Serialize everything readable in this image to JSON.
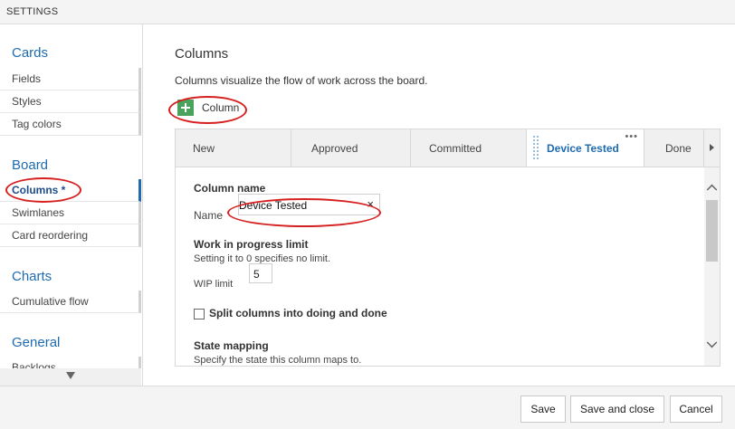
{
  "window": {
    "title": "SETTINGS"
  },
  "sidebar": {
    "sections": [
      {
        "title": "Cards",
        "items": [
          "Fields",
          "Styles",
          "Tag colors"
        ]
      },
      {
        "title": "Board",
        "items": [
          "Columns *",
          "Swimlanes",
          "Card reordering"
        ],
        "active": "Columns *"
      },
      {
        "title": "Charts",
        "items": [
          "Cumulative flow"
        ]
      },
      {
        "title": "General",
        "items": [
          "Backlogs"
        ]
      }
    ]
  },
  "main": {
    "title": "Columns",
    "description": "Columns visualize the flow of work across the board.",
    "add_column_label": "Column",
    "tabs": [
      {
        "label": "New"
      },
      {
        "label": "Approved"
      },
      {
        "label": "Committed"
      },
      {
        "label": "Device Tested",
        "active": true
      },
      {
        "label": "Done"
      }
    ],
    "form": {
      "column_name_heading": "Column name",
      "name_label": "Name",
      "name_value": "Device Tested",
      "clear_symbol": "×",
      "wip_heading": "Work in progress limit",
      "wip_hint": "Setting it to 0 specifies no limit.",
      "wip_label": "WIP limit",
      "wip_value": "5",
      "split_label": "Split columns into doing and done",
      "split_checked": false,
      "state_heading": "State mapping",
      "state_hint": "Specify the state this column maps to."
    }
  },
  "footer": {
    "save_label": "Save",
    "save_close_label": "Save and close",
    "cancel_label": "Cancel"
  },
  "colors": {
    "accent": "#1e6bb0",
    "add_button": "#4aa35c",
    "annotation": "#d62020"
  },
  "icons": {
    "add": "plus-icon",
    "clear": "close-icon",
    "scroll_up": "chevron-up-icon",
    "scroll_down": "chevron-down-icon",
    "tabs_next": "chevron-right-icon",
    "sidebar_down": "triangle-down-icon"
  }
}
